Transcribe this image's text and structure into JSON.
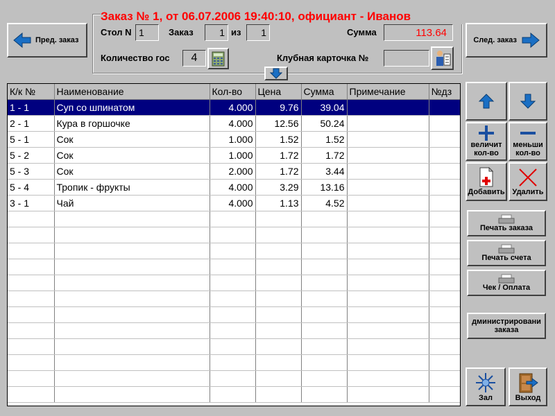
{
  "header": {
    "title": "Заказ № 1, от 06.07.2006 19:40:10, официант - Иванов",
    "table_label": "Стол N",
    "table_value": "1",
    "order_label": "Заказ",
    "order_value": "1",
    "of_label": "из",
    "of_value": "1",
    "sum_label": "Сумма",
    "sum_value": "113.64",
    "guests_label": "Количество гос",
    "guests_value": "4",
    "card_label": "Клубная карточка №",
    "card_value": ""
  },
  "nav": {
    "prev_label": "Пред. заказ",
    "next_label": "След. заказ"
  },
  "columns": [
    "К/к №",
    "Наименование",
    "Кол-во",
    "Цена",
    "Сумма",
    "Примечание",
    "№дз"
  ],
  "rows": [
    {
      "code": "1 - 1",
      "name": "Суп со шпинатом",
      "qty": "4.000",
      "price": "9.76",
      "sum": "39.04",
      "note": "",
      "dz": ""
    },
    {
      "code": "2 - 1",
      "name": "Кура в горшочке",
      "qty": "4.000",
      "price": "12.56",
      "sum": "50.24",
      "note": "",
      "dz": ""
    },
    {
      "code": "5 - 1",
      "name": "Сок",
      "qty": "1.000",
      "price": "1.52",
      "sum": "1.52",
      "note": "",
      "dz": ""
    },
    {
      "code": "5 - 2",
      "name": "Сок",
      "qty": "1.000",
      "price": "1.72",
      "sum": "1.72",
      "note": "",
      "dz": ""
    },
    {
      "code": "5 - 3",
      "name": "Сок",
      "qty": "2.000",
      "price": "1.72",
      "sum": "3.44",
      "note": "",
      "dz": ""
    },
    {
      "code": "5 - 4",
      "name": "Тропик - фрукты",
      "qty": "4.000",
      "price": "3.29",
      "sum": "13.16",
      "note": "",
      "dz": ""
    },
    {
      "code": "3 - 1",
      "name": "Чай",
      "qty": "4.000",
      "price": "1.13",
      "sum": "4.52",
      "note": "",
      "dz": ""
    }
  ],
  "selected_row": 0,
  "side": {
    "increase_label_1": "величит",
    "increase_label_2": "кол-во",
    "decrease_label_1": "меньши",
    "decrease_label_2": "кол-во",
    "add_label": "Добавить",
    "delete_label": "Удалить",
    "print_order_label": "Печать заказа",
    "print_bill_label": "Печать счета",
    "check_label": "Чек / Оплата",
    "admin_label_1": "дминистрировани",
    "admin_label_2": "заказа",
    "hall_label": "Зал",
    "exit_label": "Выход"
  },
  "colors": {
    "title": "#ff0000",
    "sum": "#ff0000",
    "selection": "#00007f",
    "arrow": "#1a6fc4"
  }
}
